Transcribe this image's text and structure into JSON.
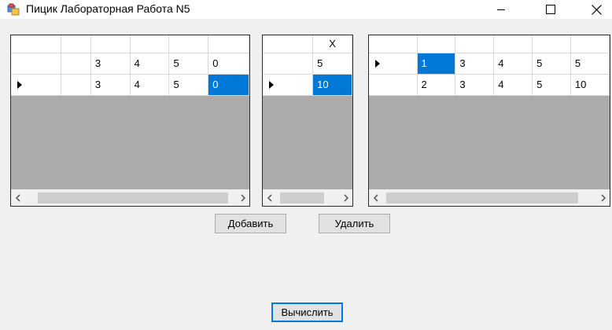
{
  "window": {
    "title": "Пицик Лабораторная Работа N5"
  },
  "grid_left": {
    "header": [
      "",
      "",
      "",
      "",
      "",
      ""
    ],
    "rows": [
      [
        "",
        "",
        "3",
        "4",
        "5",
        "0"
      ],
      [
        "",
        "",
        "3",
        "4",
        "5",
        "0"
      ]
    ],
    "selected_cell": {
      "row": 1,
      "col": 5
    },
    "current_row": 1
  },
  "grid_middle": {
    "header": [
      "",
      "X"
    ],
    "rows": [
      [
        "",
        "5"
      ],
      [
        "",
        "10"
      ]
    ],
    "selected_cell": {
      "row": 1,
      "col": 1
    },
    "current_row": 1
  },
  "grid_right": {
    "header": [
      "",
      "",
      "",
      "",
      "",
      ""
    ],
    "rows": [
      [
        "",
        "1",
        "3",
        "4",
        "5",
        "5"
      ],
      [
        "",
        "2",
        "3",
        "4",
        "5",
        "10"
      ]
    ],
    "selected_cell": {
      "row": 0,
      "col": 1
    },
    "current_row": 0
  },
  "buttons": {
    "add": "Добавить",
    "delete": "Удалить",
    "calculate": "Вычислить"
  },
  "icons": {
    "app": "app-window-icon",
    "minimize": "minimize-icon",
    "maximize": "maximize-icon",
    "close": "close-icon",
    "scroll_left": "chevron-left-icon",
    "scroll_right": "chevron-right-icon",
    "row_indicator": "row-pointer-icon"
  },
  "colors": {
    "selection": "#0078d7",
    "grid_background": "#ababab",
    "window_background": "#f0f0f0"
  }
}
